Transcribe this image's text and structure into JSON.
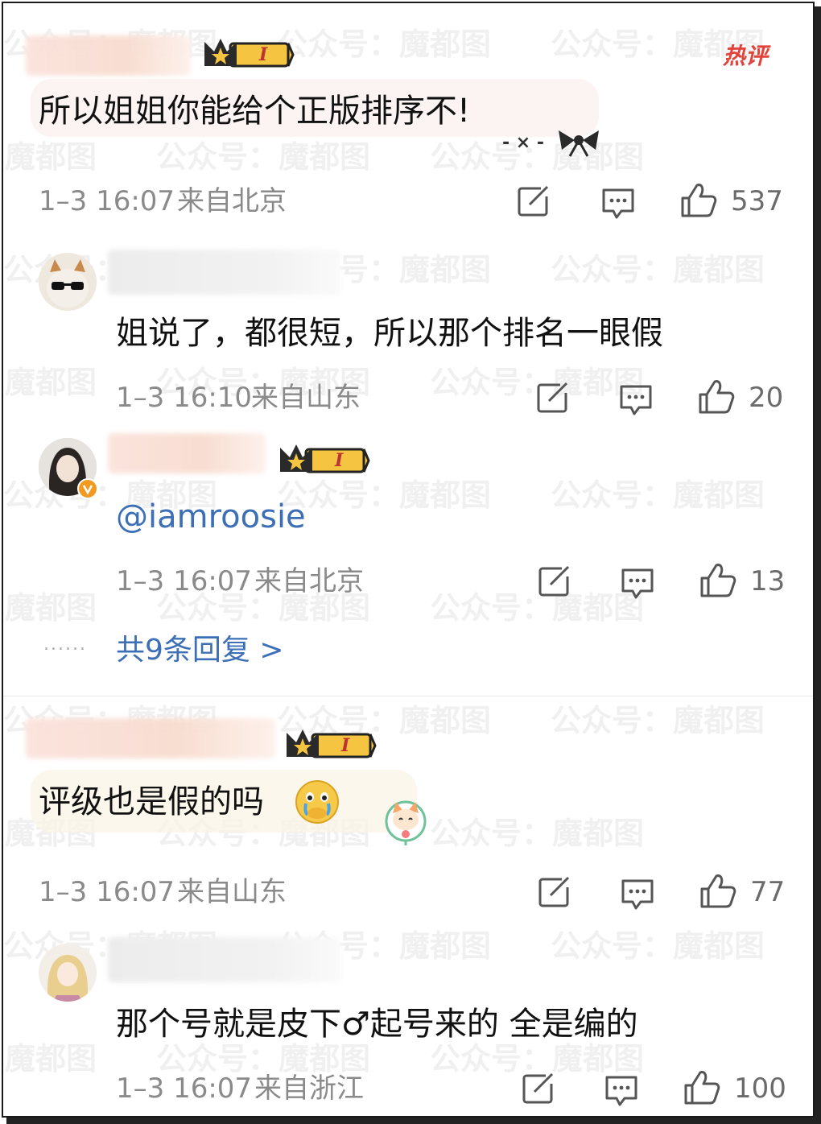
{
  "hot_label": "热评",
  "watermark": "公众号：魔都图",
  "badge_letter": "I",
  "comments": [
    {
      "text": "所以姐姐你能给个正版排序不!",
      "time": "1–3 16:07",
      "location": "来自北京",
      "likes": "537"
    },
    {
      "text": "姐说了，都很短，所以那个排名一眼假",
      "time": "1–3 16:10",
      "location": "来自山东",
      "likes": "20"
    },
    {
      "text": "@iamroosie",
      "time": "1–3 16:07",
      "location": "来自北京",
      "likes": "13"
    },
    {
      "text": "评级也是假的吗",
      "time": "1–3 16:07",
      "location": "来自山东",
      "likes": "77"
    },
    {
      "text": "那个号就是皮下♂起号来的 全是编的",
      "time": "1–3 16:07",
      "location": "来自浙江",
      "likes": "100"
    }
  ],
  "reply_summary": "共9条回复 >",
  "dots": "......",
  "icons": [
    "share-icon",
    "comment-icon",
    "like-icon",
    "crown-badge-icon",
    "bow-icon",
    "cry-emoji-icon",
    "cat-sticker-icon"
  ],
  "colors": {
    "link": "#3d6fb6",
    "hot": "#e2423a",
    "meta": "#8a8a8a"
  }
}
